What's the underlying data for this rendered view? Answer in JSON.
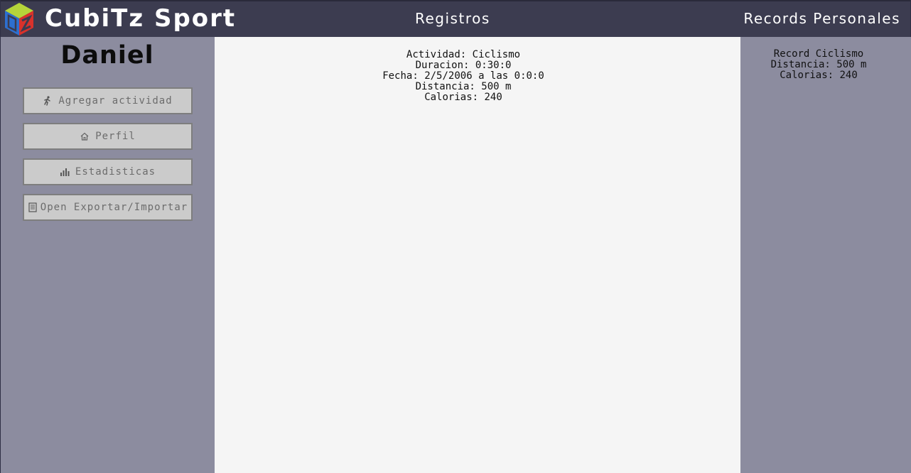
{
  "header": {
    "brand": "CubiTz Sport",
    "nav_registros": "Registros",
    "nav_records": "Records Personales"
  },
  "sidebar": {
    "username": "Daniel",
    "buttons": [
      {
        "label": "Agregar actividad",
        "icon": "running-person-icon"
      },
      {
        "label": "Perfil",
        "icon": "home-icon"
      },
      {
        "label": "Estadisticas",
        "icon": "bar-chart-icon"
      },
      {
        "label": "Open Exportar/Importar",
        "icon": "document-icon"
      }
    ]
  },
  "activity": {
    "actividad": "Actividad: Ciclismo",
    "duracion": "Duracion: 0:30:0",
    "fecha": "Fecha: 2/5/2006 a las 0:0:0",
    "distancia": "Distancia: 500 m",
    "calorias": "Calorias: 240"
  },
  "records": {
    "title": "Record Ciclismo",
    "distancia": "Distancia: 500 m",
    "calorias": "Calorias: 240"
  },
  "colors": {
    "topbar": "#3c3c50",
    "sidebar": "#8c8c9f",
    "main": "#f5f5f5",
    "button": "#cbcbcb"
  }
}
